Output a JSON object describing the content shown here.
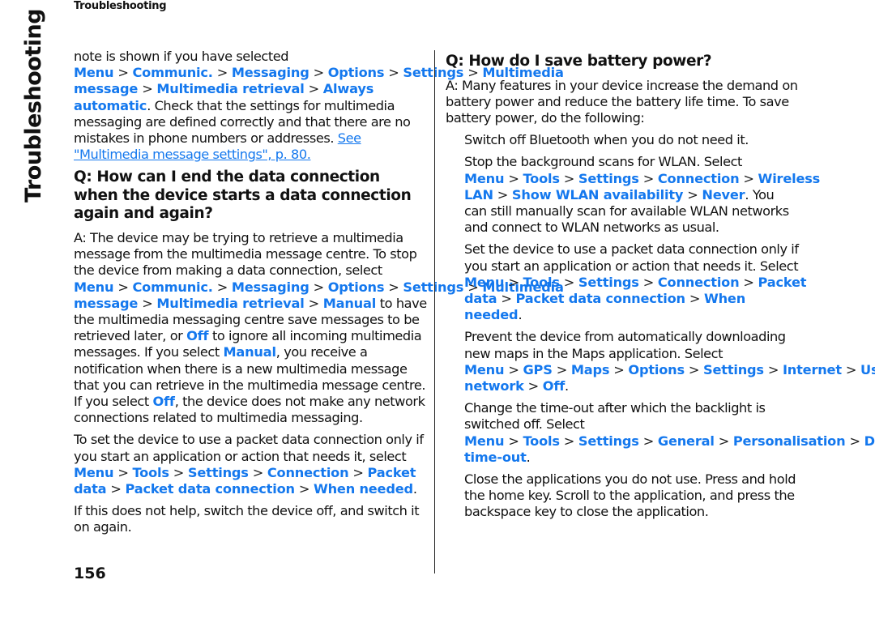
{
  "header": {
    "running_head": "Troubleshooting",
    "side_tab": "Troubleshooting"
  },
  "page_number": "156",
  "colors": {
    "link": "#1478ee",
    "text": "#111111"
  },
  "left": {
    "p1": {
      "t1": "note is shown if you have selected ",
      "path": [
        "Menu",
        "Communic.",
        "Messaging",
        "Options",
        "Settings",
        "Multimedia message",
        "Multimedia retrieval",
        "Always automatic"
      ],
      "t2": ". Check that the settings for multimedia messaging are defined correctly and that there are no mistakes in phone numbers or addresses. ",
      "xref": "See \"Multimedia message settings\", p. 80."
    },
    "q2": "Q: How can I end the data connection when the device starts a data connection again and again?",
    "a2": {
      "t1": "A: The device may be trying to retrieve a multimedia message from the multimedia message centre. To stop the device from making a data connection, select ",
      "path": [
        "Menu",
        "Communic.",
        "Messaging",
        "Options",
        "Settings",
        "Multimedia message",
        "Multimedia retrieval",
        "Manual"
      ],
      "t2": " to have the multimedia messaging centre save messages to be retrieved later, or ",
      "off": "Off",
      "t3": " to ignore all incoming multimedia messages. If you select ",
      "manual": "Manual",
      "t4": ", you receive a notification when there is a new multimedia message that you can retrieve in the multimedia message centre. If you select ",
      "off2": "Off",
      "t5": ", the device does not make any network connections related to multimedia messaging."
    },
    "p3": {
      "t1": "To set the device to use a packet data connection only if you start an application or action that needs it, select ",
      "path": [
        "Menu",
        "Tools",
        "Settings",
        "Connection",
        "Packet data",
        "Packet data connection",
        "When needed"
      ],
      "t2": "."
    },
    "p4": "If this does not help, switch the device off, and switch it on again."
  },
  "right": {
    "q": "Q: How do I save battery power?",
    "a": "A: Many features in your device increase the demand on battery power and reduce the battery life time. To save battery power, do the following:",
    "items": [
      {
        "t1": "Switch off Bluetooth when you do not need it.",
        "path": [],
        "t2": ""
      },
      {
        "t1": "Stop the background scans for WLAN. Select ",
        "path": [
          "Menu",
          "Tools",
          "Settings",
          "Connection",
          "Wireless LAN",
          "Show WLAN availability",
          "Never"
        ],
        "t2": ". You can still manually scan for available WLAN networks and connect to WLAN networks as usual."
      },
      {
        "t1": "Set the device to use a packet data connection only if you start an application or action that needs it. Select ",
        "path": [
          "Menu",
          "Tools",
          "Settings",
          "Connection",
          "Packet data",
          "Packet data connection",
          "When needed"
        ],
        "t2": "."
      },
      {
        "t1": "Prevent the device from automatically downloading new maps in the Maps application. Select ",
        "path": [
          "Menu",
          "GPS",
          "Maps",
          "Options",
          "Settings",
          "Internet",
          "Use network",
          "Off"
        ],
        "t2": "."
      },
      {
        "t1": "Change the time-out after which the backlight is switched off. Select ",
        "path": [
          "Menu",
          "Tools",
          "Settings",
          "General",
          "Personalisation",
          "Display",
          "Light time-out"
        ],
        "t2": "."
      },
      {
        "t1": "Close the applications you do not use. Press and hold the home key. Scroll to the application, and press the backspace key to close the application.",
        "path": [],
        "t2": ""
      }
    ],
    "separator": ">"
  }
}
